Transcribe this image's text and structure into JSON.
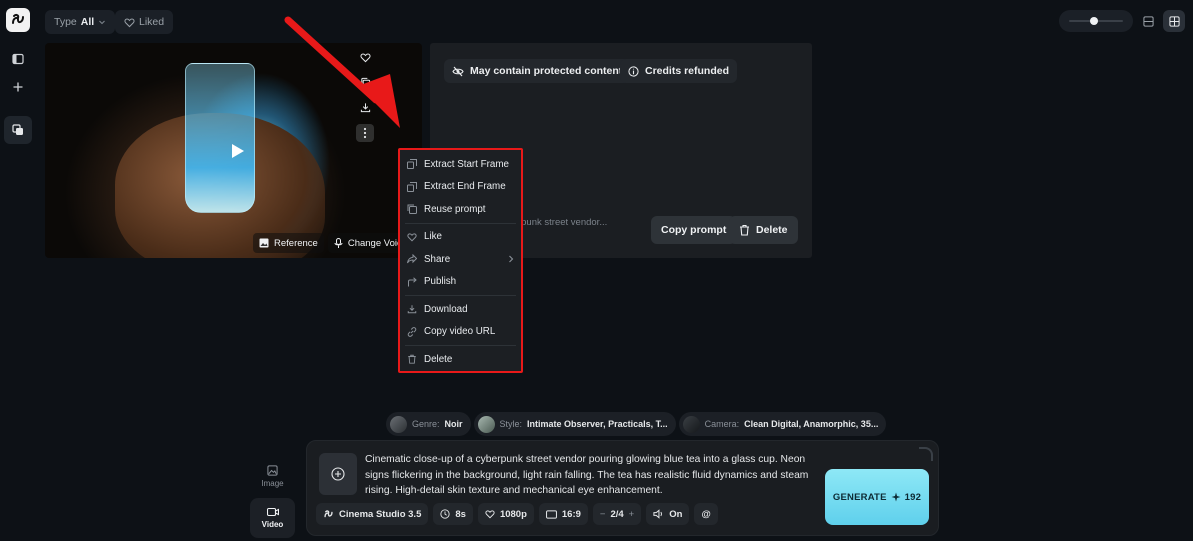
{
  "toolbar": {
    "type_label": "Type",
    "type_value": "All",
    "liked_label": "Liked"
  },
  "video_card": {
    "reference_label": "Reference",
    "change_voice_label": "Change Voice"
  },
  "details": {
    "protected_tag": "May contain protected content",
    "credits_tag": "Credits refunded",
    "prompt_preview": "a cyberpunk street vendor...",
    "copy_prompt_label": "Copy prompt",
    "delete_label": "Delete"
  },
  "context_menu": {
    "items": [
      {
        "label": "Extract Start Frame",
        "icon": "frame-icon"
      },
      {
        "label": "Extract End Frame",
        "icon": "frame-icon"
      },
      {
        "label": "Reuse prompt",
        "icon": "copy-icon"
      },
      {
        "label": "Like",
        "icon": "heart-icon"
      },
      {
        "label": "Share",
        "icon": "share-icon"
      },
      {
        "label": "Publish",
        "icon": "publish-icon"
      },
      {
        "label": "Download",
        "icon": "download-icon"
      },
      {
        "label": "Copy video URL",
        "icon": "link-icon"
      },
      {
        "label": "Delete",
        "icon": "trash-icon"
      }
    ]
  },
  "tags": {
    "genre_key": "Genre:",
    "genre_value": "Noir",
    "style_key": "Style:",
    "style_value": "Intimate Observer, Practicals, T...",
    "camera_key": "Camera:",
    "camera_value": "Clean Digital, Anamorphic, 35..."
  },
  "modes": {
    "image_label": "Image",
    "video_label": "Video"
  },
  "composer": {
    "prompt": "Cinematic close-up of a cyberpunk street vendor pouring glowing blue tea into a glass cup. Neon signs flickering in the background, light rain falling. The tea has realistic fluid dynamics and steam rising. High-detail skin texture and mechanical eye enhancement.",
    "model": "Cinema Studio 3.5",
    "duration": "8s",
    "resolution": "1080p",
    "aspect": "16:9",
    "count": "2/4",
    "sound": "On",
    "mention": "@",
    "generate_label": "GENERATE",
    "generate_cost": "192"
  },
  "colors": {
    "background": "#0d1116",
    "accent": "#6fdcf0",
    "annotation_red": "#e81919"
  }
}
